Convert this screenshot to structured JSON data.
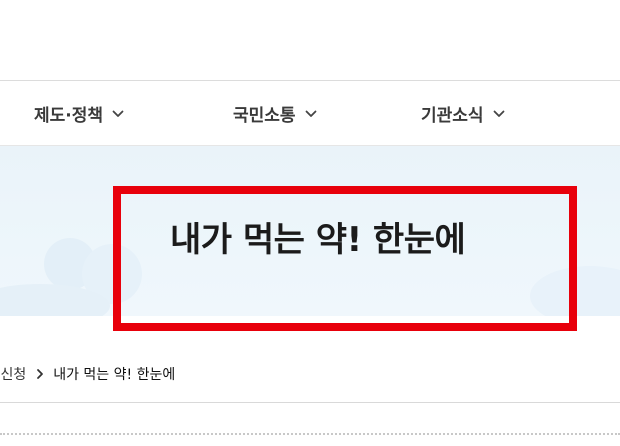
{
  "nav": {
    "items": [
      {
        "label": "제도·정책"
      },
      {
        "label": "국민소통"
      },
      {
        "label": "기관소식"
      }
    ]
  },
  "banner": {
    "title": "내가 먹는 약! 한눈에",
    "highlight_color": "#e8000b",
    "background_color": "#edf6fb"
  },
  "breadcrumb": {
    "previous": "·신청",
    "current": "내가 먹는 약! 한눈에"
  },
  "icons": {
    "nav_dropdown": "chevron-down-icon",
    "breadcrumb_separator": "chevron-right-icon"
  }
}
